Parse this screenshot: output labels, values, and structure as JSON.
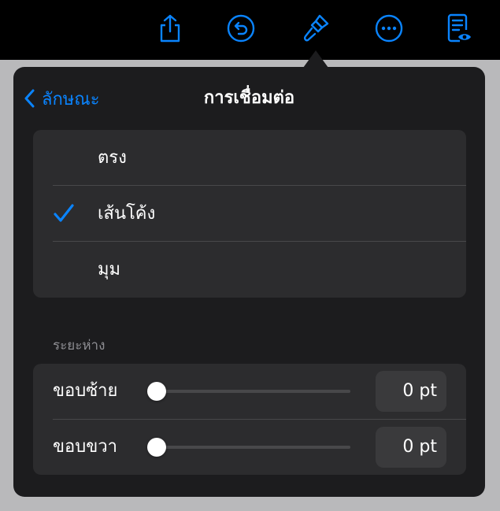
{
  "header": {
    "back_label": "ลักษณะ",
    "title": "การเชื่อมต่อ"
  },
  "toolbar": {
    "icons": [
      "share-icon",
      "undo-icon",
      "format-brush-icon",
      "more-icon",
      "reader-view-icon"
    ],
    "accent": "#0a84ff"
  },
  "connection_options": [
    {
      "label": "ตรง",
      "selected": false
    },
    {
      "label": "เส้นโค้ง",
      "selected": true
    },
    {
      "label": "มุม",
      "selected": false
    }
  ],
  "spacing": {
    "section_label": "ระยะห่าง",
    "rows": [
      {
        "label": "ขอบซ้าย",
        "value": "0 pt",
        "level": 0
      },
      {
        "label": "ขอบขวา",
        "value": "0 pt",
        "level": 0
      }
    ]
  }
}
